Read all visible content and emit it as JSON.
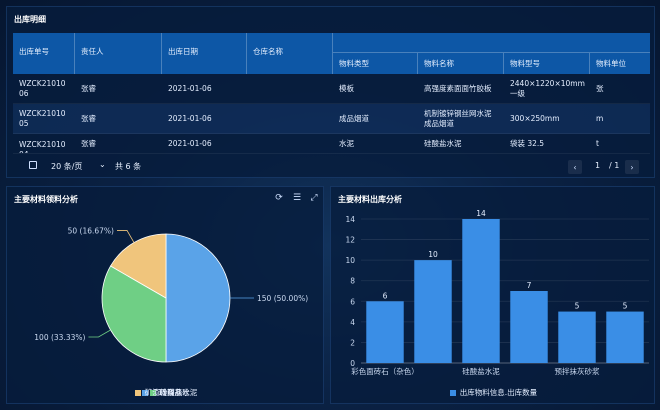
{
  "table_panel": {
    "title": "出库明细",
    "headers": {
      "order_no": "出库单号",
      "person": "责任人",
      "date": "出库日期",
      "warehouse": "仓库名称",
      "material_type": "物料类型",
      "material_name": "物料名称",
      "material_model": "物料型号",
      "material_unit": "物料单位"
    },
    "rows": [
      {
        "order_no": "WZCK2101006",
        "person": "张睿",
        "date": "2021-01-06",
        "warehouse": "",
        "material_type": "模板",
        "material_name": "高强度素面面竹胶板",
        "material_model": "2440×1220×10mm 一级",
        "material_unit": "张"
      },
      {
        "order_no": "WZCK2101005",
        "person": "张睿",
        "date": "2021-01-06",
        "warehouse": "",
        "material_type": "成品烟道",
        "material_name": "机制镀锌钢丝网水泥成品烟道",
        "material_model": "300×250mm",
        "material_unit": "m"
      },
      {
        "order_no": "WZCK2101004",
        "person": "张睿",
        "date": "2021-01-06",
        "warehouse": "",
        "material_type": "水泥",
        "material_name": "硅酸盐水泥",
        "material_model": "袋装 32.5",
        "material_unit": "t"
      }
    ],
    "pager": {
      "page_size": "20 条/页",
      "total": "共 6 条",
      "current_page": "1",
      "page_count": "/ 1",
      "prev_icon": "chevron-left-icon",
      "next_icon": "chevron-right-icon"
    }
  },
  "pie_panel": {
    "title": "主要材料领料分析",
    "tools": [
      "refresh-icon",
      "data-view-icon",
      "save-image-icon"
    ],
    "slices": [
      {
        "name": "C15商品砼",
        "value": 150,
        "label": "150 (50.00%)",
        "color": "#5aa3e8"
      },
      {
        "name": "粉煤灰",
        "value": 100,
        "label": "100 (33.33%)",
        "color": "#6fcf85"
      },
      {
        "name": "矿渣硅酸盐水泥",
        "value": 50,
        "label": "50 (16.67%)",
        "color": "#f0c57c"
      }
    ]
  },
  "chart_data": {
    "type": "bar",
    "title": "主要材料出库分析",
    "categories": [
      "彩色面砖石（杂色）",
      "",
      "硅酸盐水泥",
      "",
      "预拌抹灰砂浆",
      ""
    ],
    "tick_labels_shown": [
      "彩色面砖石（杂色）",
      "硅酸盐水泥",
      "预拌抹灰砂浆"
    ],
    "series": [
      {
        "name": "出库物料信息.出库数量",
        "values": [
          6,
          10,
          14,
          7,
          5,
          5
        ],
        "color": "#3a8ee6"
      }
    ],
    "ylim": [
      0,
      14
    ],
    "yticks": [
      0,
      2,
      4,
      6,
      8,
      10,
      12,
      14
    ],
    "grid": true,
    "legend": "bottom"
  }
}
